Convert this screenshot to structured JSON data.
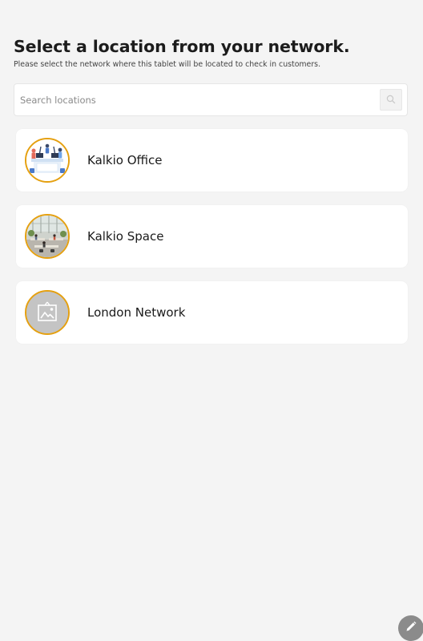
{
  "header": {
    "title": "Select a location from your network.",
    "subtitle": "Please select the network where this tablet will be located to check in customers."
  },
  "search": {
    "placeholder": "Search locations",
    "value": "",
    "button_icon": "search-icon"
  },
  "locations": [
    {
      "name": "Kalkio Office",
      "image": "office-desk-illustration"
    },
    {
      "name": "Kalkio Space",
      "image": "coworking-space-photo"
    },
    {
      "name": "London Network",
      "image": "image-placeholder-icon"
    }
  ],
  "fab": {
    "icon": "pencil-icon"
  },
  "colors": {
    "background": "#f4f4f4",
    "card": "#ffffff",
    "avatar_ring": "#e5a010",
    "fab": "#8b8b8b"
  }
}
